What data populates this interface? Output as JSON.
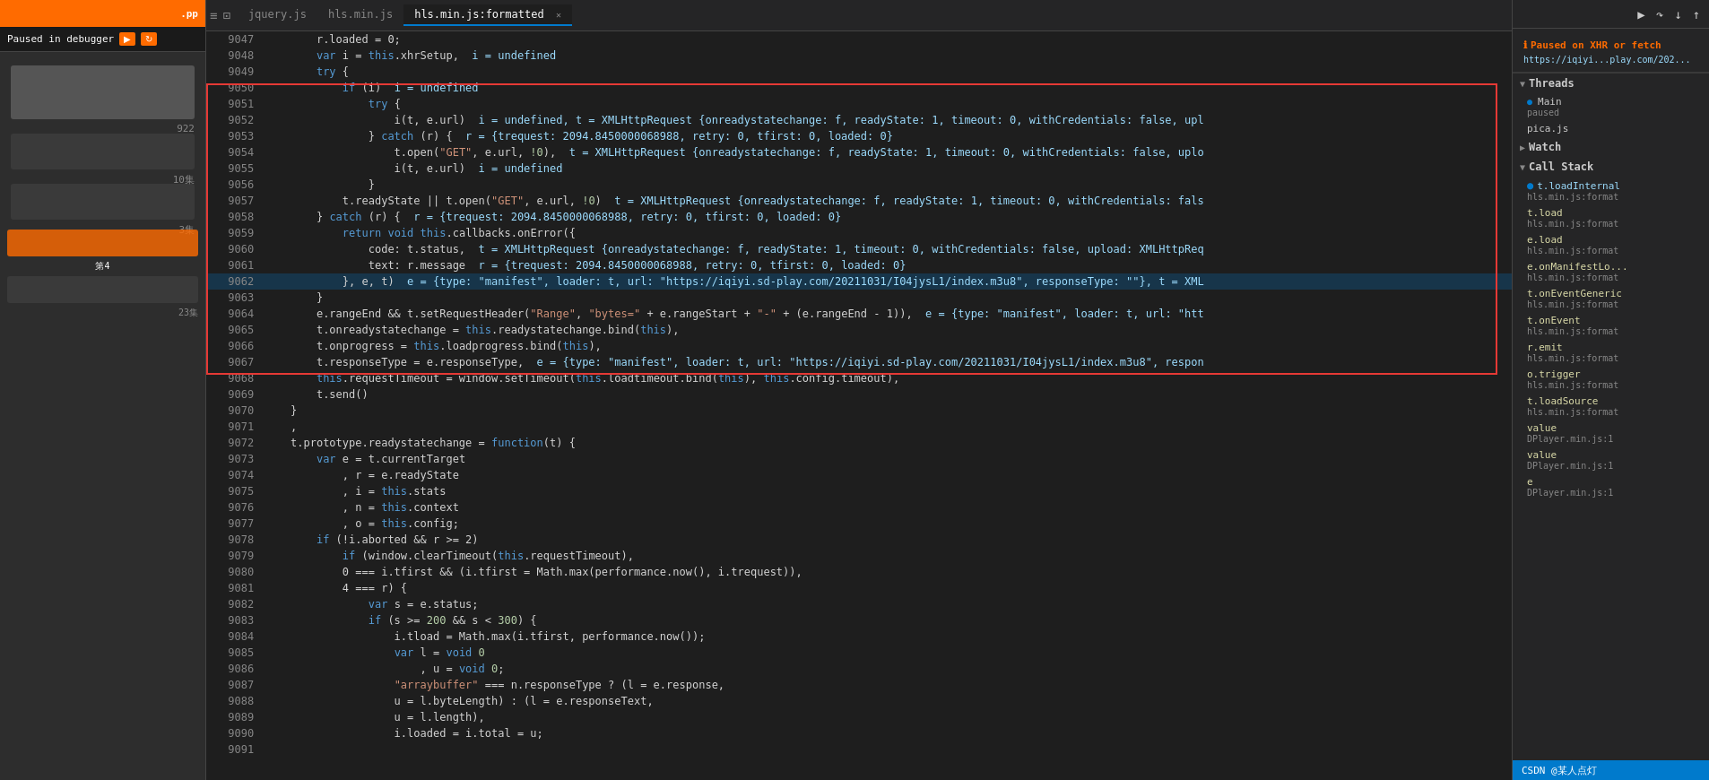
{
  "leftSidebar": {
    "appLabel": ".pp",
    "debuggerLabel": "Paused in debugger",
    "sidebarNumbers": [
      "922",
      "10集",
      "3集",
      "23集",
      "第4"
    ]
  },
  "tabs": {
    "items": [
      {
        "label": "jquery.js",
        "active": false,
        "closeable": false
      },
      {
        "label": "hls.min.js",
        "active": false,
        "closeable": false
      },
      {
        "label": "hls.min.js:formatted",
        "active": true,
        "closeable": true
      }
    ]
  },
  "code": {
    "lines": [
      {
        "num": 9047,
        "content": "        r.loaded = 0;"
      },
      {
        "num": 9048,
        "content": "        var i = this.xhrSetup,  i = undefined"
      },
      {
        "num": 9049,
        "content": "        try {"
      },
      {
        "num": 9050,
        "content": "            if (i)  i = undefined"
      },
      {
        "num": 9051,
        "content": "                try {"
      },
      {
        "num": 9052,
        "content": "                    i(t, e.url)  i = undefined, t = XMLHttpRequest {onreadystatechange: f, readyState: 1, timeout: 0, withCredentials: false, upl"
      },
      {
        "num": 9053,
        "content": "                } catch (r) {  r = {trequest: 2094.8450000068988, retry: 0, tfirst: 0, loaded: 0}"
      },
      {
        "num": 9054,
        "content": "                    t.open(\"GET\", e.url, !0),  t = XMLHttpRequest {onreadystatechange: f, readyState: 1, timeout: 0, withCredentials: false, uplo"
      },
      {
        "num": 9055,
        "content": "                    i(t, e.url)  i = undefined"
      },
      {
        "num": 9056,
        "content": "                }"
      },
      {
        "num": 9057,
        "content": "            t.readyState || t.open(\"GET\", e.url, !0)  t = XMLHttpRequest {onreadystatechange: f, readyState: 1, timeout: 0, withCredentials: fals"
      },
      {
        "num": 9058,
        "content": "        } catch (r) {  r = {trequest: 2094.8450000068988, retry: 0, tfirst: 0, loaded: 0}"
      },
      {
        "num": 9059,
        "content": "            return void this.callbacks.onError({"
      },
      {
        "num": 9060,
        "content": "                code: t.status,  t = XMLHttpRequest {onreadystatechange: f, readyState: 1, timeout: 0, withCredentials: false, upload: XMLHttpReq"
      },
      {
        "num": 9061,
        "content": "                text: r.message  r = {trequest: 2094.8450000068988, retry: 0, tfirst: 0, loaded: 0}"
      },
      {
        "num": 9062,
        "content": "            }, e, t)  e = {type: \"manifest\", loader: t, url: \"https://iqiyi.sd-play.com/20211031/I04jysL1/index.m3u8\", responseType: \"\"}, t = XML"
      },
      {
        "num": 9063,
        "content": "        }"
      },
      {
        "num": 9064,
        "content": "        e.rangeEnd && t.setRequestHeader(\"Range\", \"bytes=\" + e.rangeStart + \"-\" + (e.rangeEnd - 1)),  e = {type: \"manifest\", loader: t, url: \"htt"
      },
      {
        "num": 9065,
        "content": "        t.onreadystatechange = this.readystatechange.bind(this),"
      },
      {
        "num": 9066,
        "content": "        t.onprogress = this.loadprogress.bind(this),"
      },
      {
        "num": 9067,
        "content": "        t.responseType = e.responseType,  e = {type: \"manifest\", loader: t, url: \"https://iqiyi.sd-play.com/20211031/I04jysL1/index.m3u8\", respon"
      },
      {
        "num": 9068,
        "content": "        this.requestTimeout = window.setTimeout(this.loadtimeout.bind(this), this.config.timeout),"
      },
      {
        "num": 9069,
        "content": "        t.send()"
      },
      {
        "num": 9070,
        "content": "    }"
      },
      {
        "num": 9071,
        "content": "    ,"
      },
      {
        "num": 9072,
        "content": "    t.prototype.readystatechange = function(t) {"
      },
      {
        "num": 9073,
        "content": "        var e = t.currentTarget"
      },
      {
        "num": 9074,
        "content": "            , r = e.readyState"
      },
      {
        "num": 9075,
        "content": "            , i = this.stats"
      },
      {
        "num": 9076,
        "content": "            , n = this.context"
      },
      {
        "num": 9077,
        "content": "            , o = this.config;"
      },
      {
        "num": 9078,
        "content": "        if (!i.aborted && r >= 2)"
      },
      {
        "num": 9079,
        "content": "            if (window.clearTimeout(this.requestTimeout),"
      },
      {
        "num": 9080,
        "content": "            0 === i.tfirst && (i.tfirst = Math.max(performance.now(), i.trequest)),"
      },
      {
        "num": 9081,
        "content": "            4 === r) {"
      },
      {
        "num": 9082,
        "content": "                var s = e.status;"
      },
      {
        "num": 9083,
        "content": "                if (s >= 200 && s < 300) {"
      },
      {
        "num": 9084,
        "content": "                    i.tload = Math.max(i.tfirst, performance.now());"
      },
      {
        "num": 9085,
        "content": "                    var l = void 0"
      },
      {
        "num": 9086,
        "content": "                        , u = void 0;"
      },
      {
        "num": 9087,
        "content": "                    \"arraybuffer\" === n.responseType ? (l = e.response,"
      },
      {
        "num": 9088,
        "content": "                    u = l.byteLength) : (l = e.responseText,"
      },
      {
        "num": 9089,
        "content": "                    u = l.length),"
      },
      {
        "num": 9090,
        "content": "                    i.loaded = i.total = u;"
      },
      {
        "num": 9091,
        "content": ""
      }
    ]
  },
  "rightPanel": {
    "pausedHeader": "Paused on XHR or fetch",
    "pausedUrl": "https://iqiyi...play.com/202...",
    "threads": {
      "label": "Threads",
      "items": [
        {
          "name": "Main",
          "status": "paused"
        },
        {
          "name": "pica.js",
          "status": ""
        }
      ]
    },
    "watch": {
      "label": "Watch"
    },
    "callStack": {
      "label": "Call Stack",
      "items": [
        {
          "name": "t.loadInternal",
          "file": "hls.min.js:format",
          "current": true
        },
        {
          "name": "t.load",
          "file": "hls.min.js:format",
          "current": false
        },
        {
          "name": "e.load",
          "file": "hls.min.js:format",
          "current": false
        },
        {
          "name": "e.onManifestLo...",
          "file": "hls.min.js:format",
          "current": false
        },
        {
          "name": "t.onEventGeneric",
          "file": "hls.min.js:format",
          "current": false
        },
        {
          "name": "t.onEvent",
          "file": "hls.min.js:format",
          "current": false
        },
        {
          "name": "r.emit",
          "file": "hls.min.js:format",
          "current": false
        },
        {
          "name": "o.trigger",
          "file": "hls.min.js:format",
          "current": false
        },
        {
          "name": "t.loadSource",
          "file": "hls.min.js:format",
          "current": false
        },
        {
          "name": "value",
          "file": "DPlayer.min.js:1",
          "current": false
        },
        {
          "name": "value",
          "file": "DPlayer.min.js:1",
          "current": false
        },
        {
          "name": "e",
          "file": "DPlayer.min.js:1",
          "current": false
        }
      ]
    }
  },
  "bottomBar": {
    "text": "CSDN @某人点灯"
  }
}
